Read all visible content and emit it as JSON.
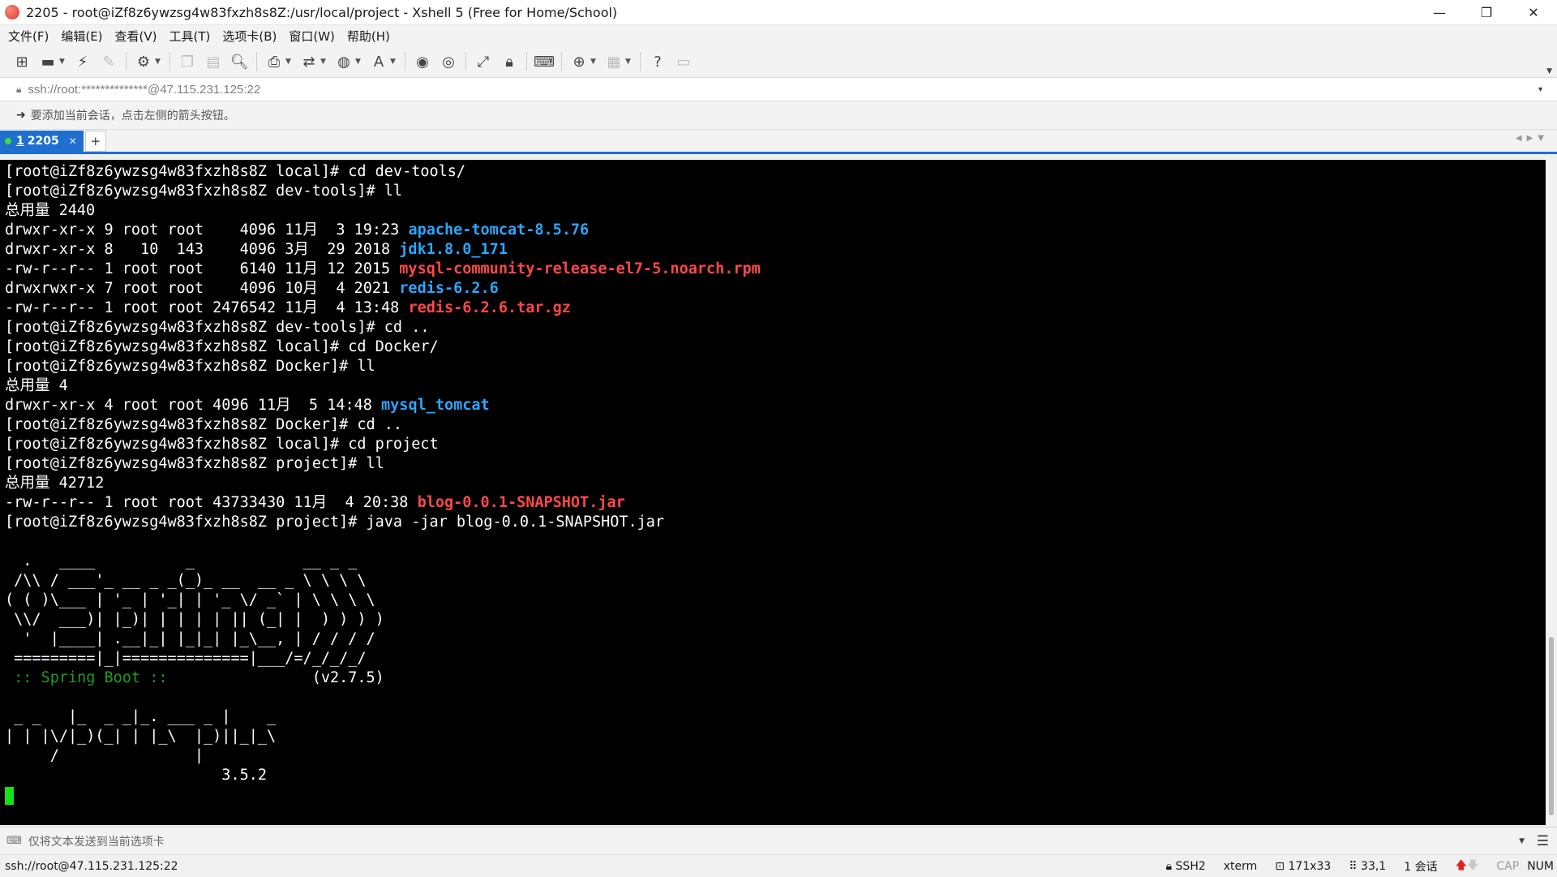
{
  "window": {
    "title": "2205 - root@iZf8z6ywzsg4w83fxzh8s8Z:/usr/local/project - Xshell 5 (Free for Home/School)",
    "controls": {
      "minimize": "—",
      "restore": "❐",
      "close": "✕"
    }
  },
  "menu": [
    "文件(F)",
    "编辑(E)",
    "查看(V)",
    "工具(T)",
    "选项卡(B)",
    "窗口(W)",
    "帮助(H)"
  ],
  "toolbar_icons": [
    "new-session-icon",
    "open-folder-icon",
    "connect-icon",
    "disconnect-icon",
    "properties-icon",
    "copy-icon",
    "paste-icon",
    "find-icon",
    "print-icon",
    "transfer-icon",
    "globe-icon",
    "font-icon",
    "xftp-icon",
    "xmanager-icon",
    "fullscreen-icon",
    "lock-icon",
    "keyboard-icon",
    "compose-icon",
    "layout-icon",
    "help-icon",
    "chat-icon"
  ],
  "address": {
    "value": "ssh://root:**************@47.115.231.125:22"
  },
  "hint": {
    "text": "要添加当前会话，点击左侧的箭头按钮。"
  },
  "tabs": [
    {
      "number": "1",
      "label": "2205",
      "active": true
    }
  ],
  "tab_add": "+",
  "terminal": {
    "lines": [
      {
        "t": "[root@iZf8z6ywzsg4w83fxzh8s8Z local]# cd dev-tools/"
      },
      {
        "t": "[root@iZf8z6ywzsg4w83fxzh8s8Z dev-tools]# ll"
      },
      {
        "t": "总用量 2440"
      },
      {
        "t": "drwxr-xr-x 9 root root    4096 11月  3 19:23 ",
        "hl": "apache-tomcat-8.5.76",
        "c": "blue"
      },
      {
        "t": "drwxr-xr-x 8   10  143    4096 3月  29 2018 ",
        "hl": "jdk1.8.0_171",
        "c": "blue"
      },
      {
        "t": "-rw-r--r-- 1 root root    6140 11月 12 2015 ",
        "hl": "mysql-community-release-el7-5.noarch.rpm",
        "c": "red"
      },
      {
        "t": "drwxrwxr-x 7 root root    4096 10月  4 2021 ",
        "hl": "redis-6.2.6",
        "c": "blue"
      },
      {
        "t": "-rw-r--r-- 1 root root 2476542 11月  4 13:48 ",
        "hl": "redis-6.2.6.tar.gz",
        "c": "red"
      },
      {
        "t": "[root@iZf8z6ywzsg4w83fxzh8s8Z dev-tools]# cd .."
      },
      {
        "t": "[root@iZf8z6ywzsg4w83fxzh8s8Z local]# cd Docker/"
      },
      {
        "t": "[root@iZf8z6ywzsg4w83fxzh8s8Z Docker]# ll"
      },
      {
        "t": "总用量 4"
      },
      {
        "t": "drwxr-xr-x 4 root root 4096 11月  5 14:48 ",
        "hl": "mysql_tomcat",
        "c": "blue"
      },
      {
        "t": "[root@iZf8z6ywzsg4w83fxzh8s8Z Docker]# cd .."
      },
      {
        "t": "[root@iZf8z6ywzsg4w83fxzh8s8Z local]# cd project"
      },
      {
        "t": "[root@iZf8z6ywzsg4w83fxzh8s8Z project]# ll"
      },
      {
        "t": "总用量 42712"
      },
      {
        "t": "-rw-r--r-- 1 root root 43733430 11月  4 20:38 ",
        "hl": "blog-0.0.1-SNAPSHOT.jar",
        "c": "red"
      },
      {
        "t": "[root@iZf8z6ywzsg4w83fxzh8s8Z project]# java -jar blog-0.0.1-SNAPSHOT.jar"
      },
      {
        "t": ""
      },
      {
        "t": "  .   ____          _            __ _ _"
      },
      {
        "t": " /\\\\ / ___'_ __ _ _(_)_ __  __ _ \\ \\ \\ \\"
      },
      {
        "t": "( ( )\\___ | '_ | '_| | '_ \\/ _` | \\ \\ \\ \\"
      },
      {
        "t": " \\\\/  ___)| |_)| | | | | || (_| |  ) ) ) )"
      },
      {
        "t": "  '  |____| .__|_| |_|_| |_\\__, | / / / /"
      },
      {
        "t": " =========|_|==============|___/=/_/_/_/"
      },
      {
        "t": "",
        "hl": " :: Spring Boot ::",
        "c": "green",
        "tail": "                (v2.7.5)"
      },
      {
        "t": ""
      },
      {
        "t": " _ _   |_  _ _|_. ___ _ |    _"
      },
      {
        "t": "| | |\\/|_)(_| | |_\\  |_)||_|_\\"
      },
      {
        "t": "     /               |"
      },
      {
        "t": "                        3.5.2"
      },
      {
        "t": "",
        "cursor": true
      }
    ]
  },
  "compose": {
    "placeholder": "仅将文本发送到当前选项卡"
  },
  "status": {
    "connection": "ssh://root@47.115.231.125:22",
    "protocol": "SSH2",
    "term": "xterm",
    "size": "171x33",
    "cursor_pos": "33,1",
    "sessions": "1 会话",
    "caps": "CAP",
    "num": "NUM"
  }
}
